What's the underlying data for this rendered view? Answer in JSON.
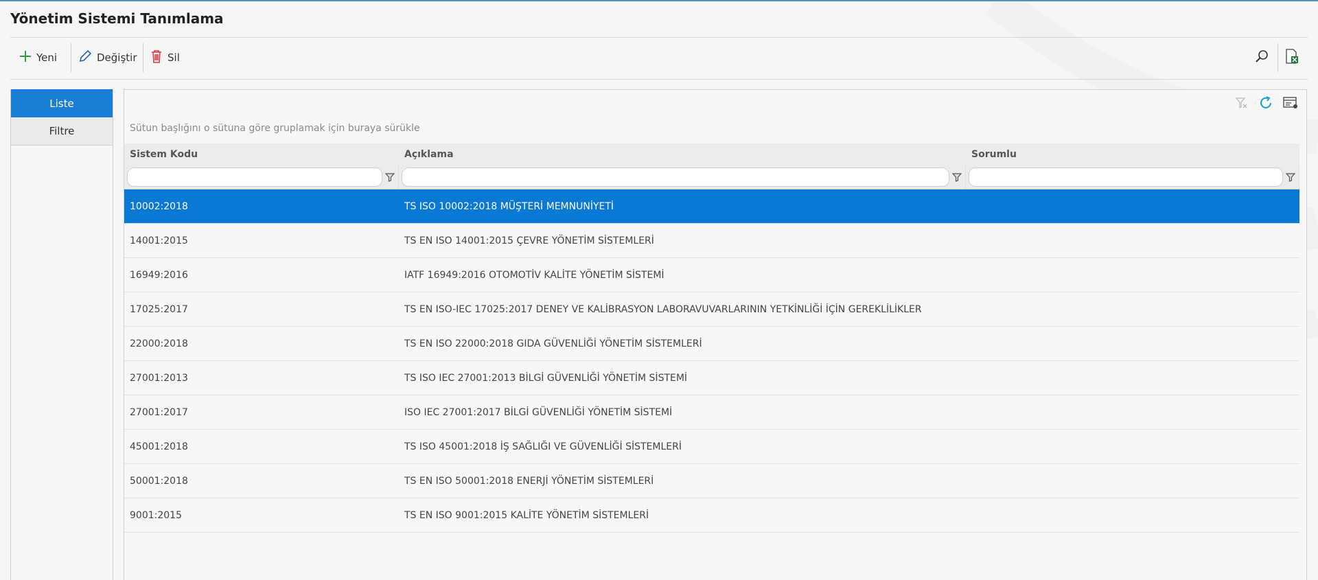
{
  "page": {
    "title": "Yönetim Sistemi Tanımlama"
  },
  "toolbar": {
    "new_label": "Yeni",
    "edit_label": "Değiştir",
    "delete_label": "Sil"
  },
  "side": {
    "tabs": [
      {
        "label": "Liste",
        "active": true
      },
      {
        "label": "Filtre",
        "active": false
      }
    ]
  },
  "grid": {
    "group_hint": "Sütun başlığını o sütuna göre gruplamak için buraya sürükle",
    "columns": [
      "Sistem Kodu",
      "Açıklama",
      "Sorumlu"
    ],
    "rows": [
      {
        "code": "10002:2018",
        "desc": "TS ISO 10002:2018 MÜŞTERİ MEMNUNİYETİ",
        "owner": "",
        "selected": true
      },
      {
        "code": "14001:2015",
        "desc": "TS EN ISO 14001:2015 ÇEVRE YÖNETİM SİSTEMLERİ",
        "owner": ""
      },
      {
        "code": "16949:2016",
        "desc": "IATF 16949:2016 OTOMOTİV KALİTE YÖNETİM SİSTEMİ",
        "owner": ""
      },
      {
        "code": "17025:2017",
        "desc": "TS EN ISO-IEC 17025:2017 DENEY VE KALİBRASYON LABORAVUVARLARININ YETKİNLİĞİ İÇİN GEREKLİLİKLER",
        "owner": ""
      },
      {
        "code": "22000:2018",
        "desc": "TS EN ISO 22000:2018 GIDA GÜVENLİĞİ YÖNETİM SİSTEMLERİ",
        "owner": ""
      },
      {
        "code": "27001:2013",
        "desc": "TS ISO IEC 27001:2013 BİLGİ GÜVENLİĞİ YÖNETİM SİSTEMİ",
        "owner": ""
      },
      {
        "code": "27001:2017",
        "desc": "ISO IEC 27001:2017 BİLGİ GÜVENLİĞİ YÖNETİM SİSTEMİ",
        "owner": ""
      },
      {
        "code": "45001:2018",
        "desc": "TS ISO 45001:2018 İŞ SAĞLIĞI VE GÜVENLİĞİ SİSTEMLERİ",
        "owner": ""
      },
      {
        "code": "50001:2018",
        "desc": "TS EN ISO 50001:2018 ENERJİ YÖNETİM SİSTEMLERİ",
        "owner": ""
      },
      {
        "code": "9001:2015",
        "desc": "TS EN ISO 9001:2015 KALİTE YÖNETİM SİSTEMLERİ",
        "owner": ""
      }
    ]
  },
  "colors": {
    "accent": "#0a79d6",
    "new_icon": "#2e9d3a",
    "delete_icon": "#d9363e",
    "refresh_icon": "#1aa1c9",
    "excel_icon": "#1d7a3e"
  },
  "icons": [
    "plus-icon",
    "pencil-icon",
    "trash-icon",
    "search-icon",
    "excel-export-icon",
    "clear-filter-icon",
    "refresh-icon",
    "column-chooser-icon",
    "funnel-icon"
  ]
}
